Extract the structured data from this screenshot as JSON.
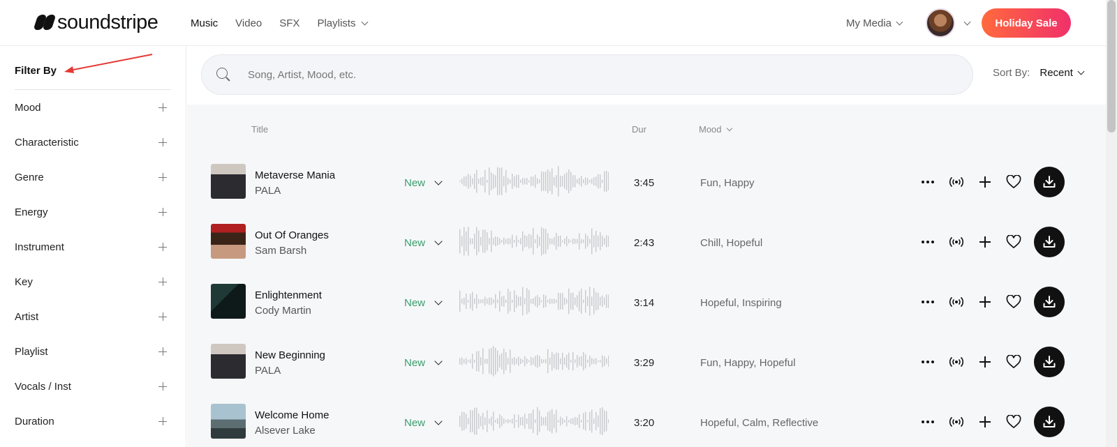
{
  "brand": {
    "name": "soundstripe"
  },
  "nav": {
    "items": [
      {
        "label": "Music",
        "active": true
      },
      {
        "label": "Video",
        "active": false
      },
      {
        "label": "SFX",
        "active": false
      },
      {
        "label": "Playlists",
        "active": false,
        "dropdown": true
      }
    ],
    "my_media": "My Media",
    "sale_button": "Holiday Sale"
  },
  "sidebar": {
    "title": "Filter By",
    "filters": [
      {
        "label": "Mood"
      },
      {
        "label": "Characteristic"
      },
      {
        "label": "Genre"
      },
      {
        "label": "Energy"
      },
      {
        "label": "Instrument"
      },
      {
        "label": "Key"
      },
      {
        "label": "Artist"
      },
      {
        "label": "Playlist"
      },
      {
        "label": "Vocals / Inst"
      },
      {
        "label": "Duration"
      }
    ]
  },
  "search": {
    "placeholder": "Song, Artist, Mood, etc.",
    "value": ""
  },
  "sort": {
    "label": "Sort By:",
    "value": "Recent"
  },
  "columns": {
    "title": "Title",
    "duration": "Dur",
    "mood": "Mood"
  },
  "tracks": [
    {
      "title": "Metaverse Mania",
      "artist": "PALA",
      "badge": "New",
      "duration": "3:45",
      "mood": "Fun, Happy"
    },
    {
      "title": "Out Of Oranges",
      "artist": "Sam Barsh",
      "badge": "New",
      "duration": "2:43",
      "mood": "Chill, Hopeful"
    },
    {
      "title": "Enlightenment",
      "artist": "Cody Martin",
      "badge": "New",
      "duration": "3:14",
      "mood": "Hopeful, Inspiring"
    },
    {
      "title": "New Beginning",
      "artist": "PALA",
      "badge": "New",
      "duration": "3:29",
      "mood": "Fun, Happy, Hopeful"
    },
    {
      "title": "Welcome Home",
      "artist": "Alsever Lake",
      "badge": "New",
      "duration": "3:20",
      "mood": "Hopeful, Calm, Reflective"
    }
  ],
  "colors": {
    "accent_green": "#3a9e6d",
    "sale_gradient_start": "#ff6a3d",
    "sale_gradient_end": "#f0306a",
    "annotation_arrow": "#e53935"
  },
  "icons": {
    "search": "search-icon",
    "more": "more-dots-icon",
    "similar": "broadcast-icon",
    "add": "plus-icon",
    "favorite": "heart-icon",
    "download": "download-icon"
  }
}
